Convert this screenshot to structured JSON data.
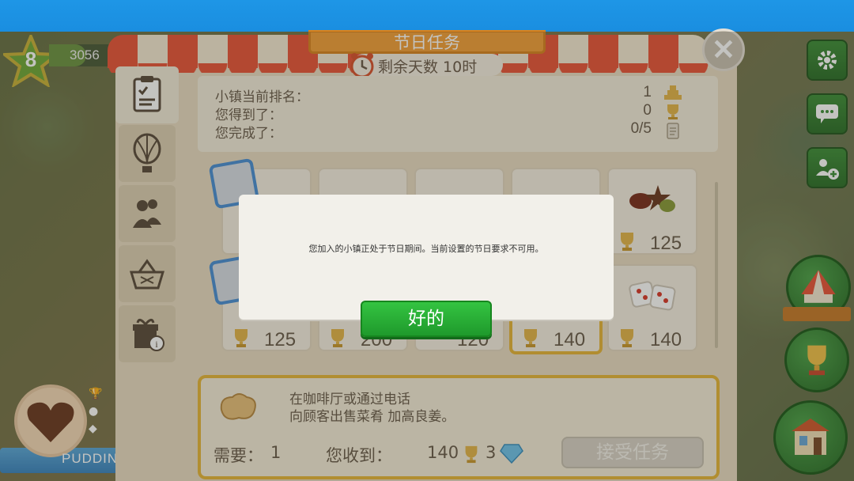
{
  "player": {
    "level": "8",
    "xp": "3056"
  },
  "panel": {
    "title": "节日任务",
    "timer": "剩余天数 10时",
    "tabs": [
      "list-icon",
      "balloon-icon",
      "people-icon",
      "gift-basket-icon",
      "gift-info-icon"
    ],
    "stats": [
      {
        "label": "小镇当前排名：",
        "value": "1",
        "icon": "rank-icon"
      },
      {
        "label": "您得到了：",
        "value": "0",
        "icon": "trophy-icon"
      },
      {
        "label": "您完成了：",
        "value": "0/5",
        "icon": "clipboard-icon"
      }
    ],
    "cards": [
      {
        "score": "125"
      },
      {
        "score": "200"
      },
      {
        "score": "120"
      },
      {
        "score": "140"
      },
      {
        "score": "125"
      },
      {
        "score": "140"
      }
    ]
  },
  "task": {
    "line1": "在咖啡厅或通过电话",
    "line2": "向顾客出售菜肴 加高良姜。",
    "need_label": "需要：",
    "need_value": "1",
    "reward_label": "您收到：",
    "reward_trophies": "140",
    "reward_gems": "3",
    "accept_label": "接受任务"
  },
  "town": {
    "name": "PUDDIN"
  },
  "dialog": {
    "message": "您加入的小镇正处于节日期间。当前设置的节日要求不可用。",
    "ok_label": "好的"
  },
  "colors": {
    "accent_green": "#2aae38",
    "accent_orange": "#f3a03a",
    "topbar_blue": "#1e96e6"
  }
}
